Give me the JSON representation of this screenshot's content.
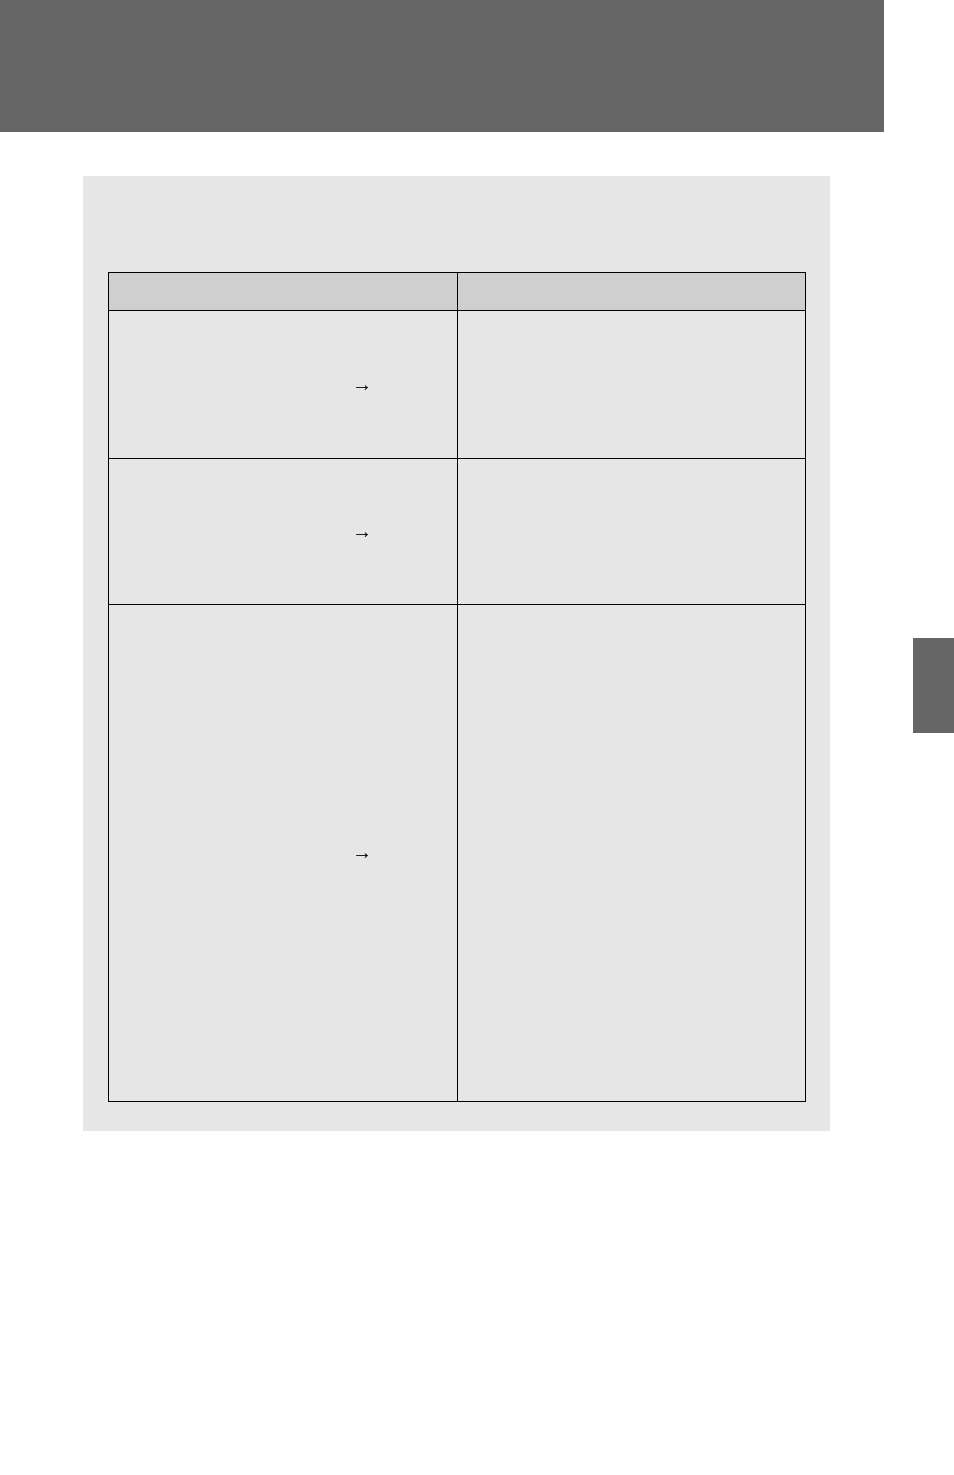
{
  "top_band": {
    "text": ""
  },
  "panel": {
    "table": {
      "headers": {
        "left": "",
        "right": ""
      },
      "rows": [
        {
          "left_label": "",
          "arrow": "→",
          "right_label": ""
        },
        {
          "left_label": "",
          "arrow": "→",
          "right_label": ""
        },
        {
          "left_label": "",
          "arrow": "→",
          "right_label": ""
        }
      ]
    }
  },
  "side_tab": {
    "label": ""
  }
}
